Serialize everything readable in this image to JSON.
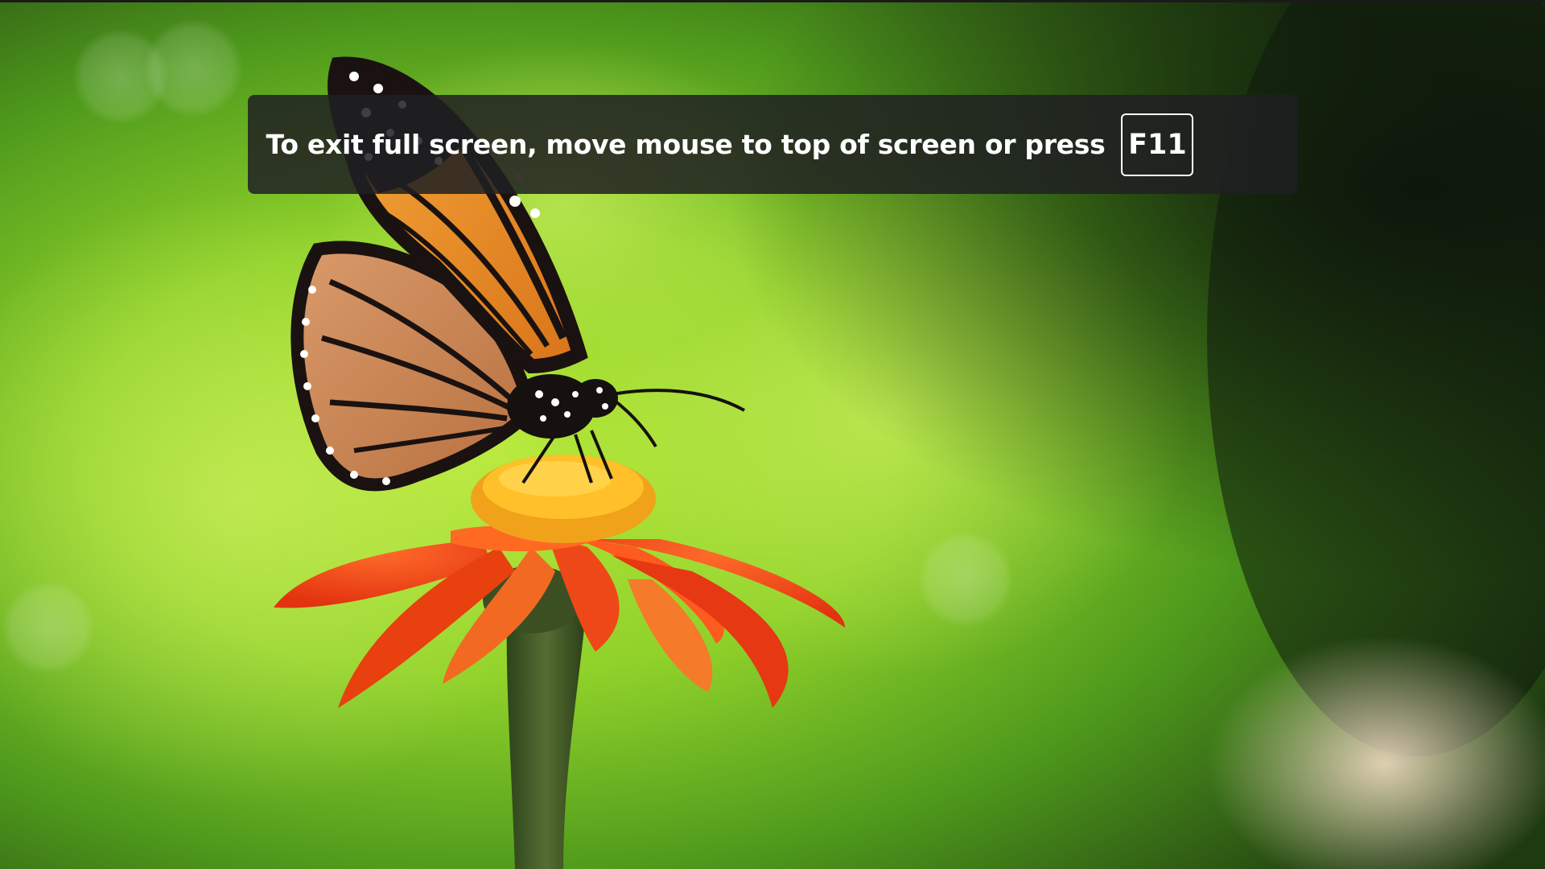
{
  "fullscreen_notice": {
    "message": "To exit full screen, move mouse to top of screen or press",
    "key": "F11"
  },
  "background": {
    "subject": "butterfly-on-flower-photo",
    "colors": {
      "foliage": "#8fd12a",
      "foliage_dark": "#2f6a12",
      "shadow": "#0f1a0c",
      "petal": "#ff4a1a",
      "pollen": "#ffb81c",
      "wing_orange": "#e98a1c",
      "wing_black": "#1a1210"
    }
  }
}
